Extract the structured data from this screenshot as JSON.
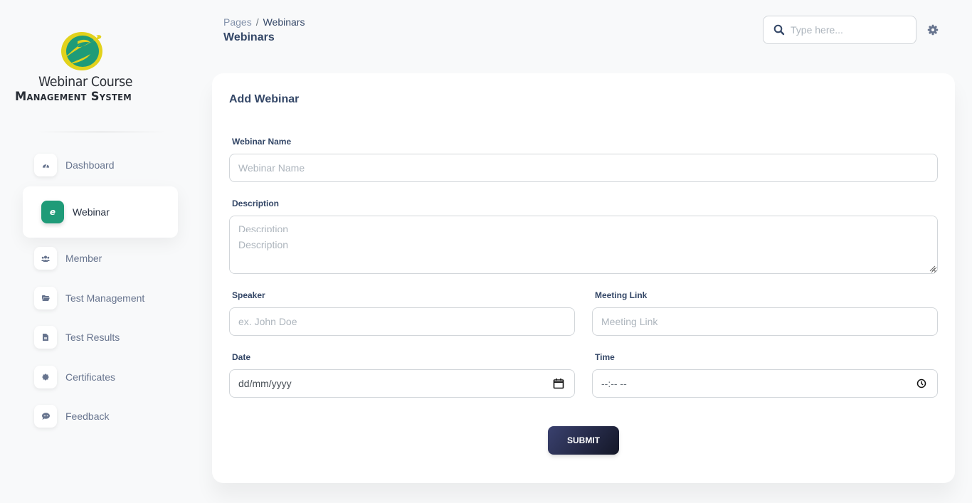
{
  "app": {
    "logo_line1": "Webinar Course",
    "logo_line2": "Management System",
    "colors": {
      "accent": "#1f9b78",
      "logo_yellow": "#e2d21c",
      "logo_green": "#1f9b78",
      "button_dark": "#252a4a"
    }
  },
  "sidebar": {
    "items": [
      {
        "label": "Dashboard",
        "icon": "dashboard-gauge-icon",
        "active": false
      },
      {
        "label": "Webinar",
        "icon": "webinar-e-icon",
        "active": true
      },
      {
        "label": "Member",
        "icon": "users-icon",
        "active": false
      },
      {
        "label": "Test Management",
        "icon": "folder-icon",
        "active": false
      },
      {
        "label": "Test Results",
        "icon": "document-icon",
        "active": false
      },
      {
        "label": "Certificates",
        "icon": "certificate-badge-icon",
        "active": false
      },
      {
        "label": "Feedback",
        "icon": "chat-bubble-icon",
        "active": false
      }
    ]
  },
  "header": {
    "breadcrumb": {
      "root": "Pages",
      "separator": "/",
      "current": "Webinars"
    },
    "title": "Webinars",
    "search": {
      "placeholder": "Type here...",
      "value": ""
    }
  },
  "form": {
    "title": "Add Webinar",
    "fields": {
      "name": {
        "label": "Webinar Name",
        "placeholder": "Webinar Name",
        "value": ""
      },
      "description": {
        "label": "Description",
        "placeholder": "Description",
        "ghost_text": "Description",
        "value": ""
      },
      "speaker": {
        "label": "Speaker",
        "placeholder": "ex. John Doe",
        "value": ""
      },
      "meeting_link": {
        "label": "Meeting Link",
        "placeholder": "Meeting Link",
        "value": ""
      },
      "date": {
        "label": "Date",
        "display": "dd/mm/yyyy"
      },
      "time": {
        "label": "Time",
        "display": "--:-- --"
      }
    },
    "submit_label": "SUBMIT"
  }
}
